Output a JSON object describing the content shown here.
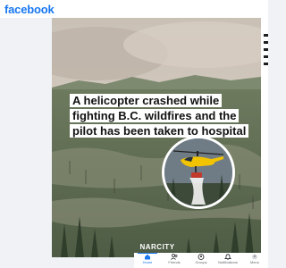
{
  "app": {
    "name": "facebook"
  },
  "post": {
    "headline": "A helicopter crashed while fighting B.C. wildfires and the pilot has been taken to hospital",
    "watermark": "NARCITY"
  },
  "bottom_nav": {
    "items": [
      {
        "label": "Home",
        "icon": "home-icon",
        "active": true
      },
      {
        "label": "Friends",
        "icon": "friends-icon",
        "active": false
      },
      {
        "label": "Groups",
        "icon": "groups-icon",
        "active": false
      },
      {
        "label": "Notifications",
        "icon": "bell-icon",
        "active": false
      },
      {
        "label": "Menu",
        "icon": "menu-icon",
        "active": false
      }
    ]
  },
  "colors": {
    "brand": "#1877f2",
    "helicopter": "#f2c300",
    "smoke": "#cfc6bc"
  }
}
